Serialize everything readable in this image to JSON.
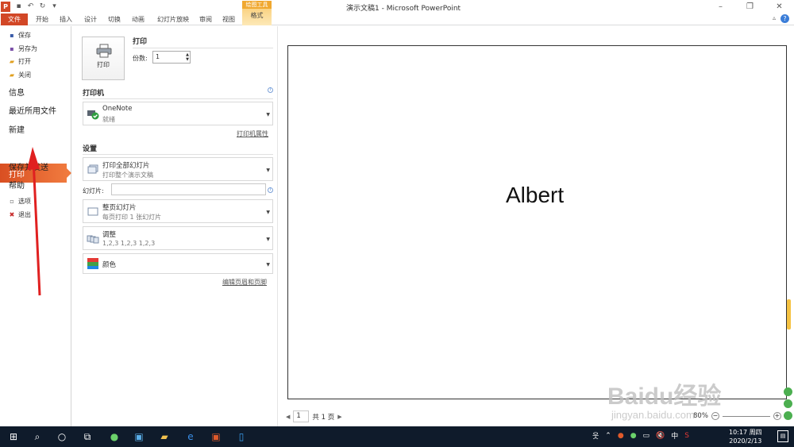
{
  "window": {
    "title": "演示文稿1 - Microsoft PowerPoint",
    "app_icon": "P",
    "controls": [
      "minimize-icon",
      "restore-icon",
      "close-icon"
    ]
  },
  "ribbon": {
    "tabs": [
      "文件",
      "开始",
      "插入",
      "设计",
      "切换",
      "动画",
      "幻灯片放映",
      "审阅",
      "视图"
    ],
    "context_group": "绘图工具",
    "context_tab": "格式"
  },
  "backstage": {
    "small_items": [
      {
        "label": "保存",
        "icon": "save-icon"
      },
      {
        "label": "另存为",
        "icon": "save-as-icon"
      },
      {
        "label": "打开",
        "icon": "open-folder-icon"
      },
      {
        "label": "关闭",
        "icon": "close-file-icon"
      }
    ],
    "big_items": [
      "信息",
      "最近所用文件",
      "新建",
      "打印",
      "保存并发送",
      "帮助"
    ],
    "selected": "打印",
    "bottom_items": [
      {
        "label": "选项",
        "icon": "options-icon"
      },
      {
        "label": "退出",
        "icon": "exit-icon"
      }
    ]
  },
  "print": {
    "button_label": "打印",
    "heading": "打印",
    "copies_label": "份数:",
    "copies_value": "1",
    "printer_heading": "打印机",
    "printer_name": "OneNote",
    "printer_status": "就绪",
    "printer_properties": "打印机属性",
    "settings_heading": "设置",
    "range_title": "打印全部幻灯片",
    "range_sub": "打印整个演示文稿",
    "slides_label": "幻灯片:",
    "slides_value": "",
    "layout_title": "整页幻灯片",
    "layout_sub": "每页打印 1 张幻灯片",
    "collate_title": "调整",
    "collate_sub": "1,2,3    1,2,3    1,2,3",
    "color_title": "颜色",
    "edit_header_footer": "编辑页眉和页脚"
  },
  "preview": {
    "slide_text": "Albert",
    "page_value": "1",
    "page_total": "共 1 页",
    "zoom": "80%"
  },
  "watermark": {
    "line1": "Baidu经验",
    "line2": "jingyan.baidu.com"
  },
  "taskbar": {
    "tray_ime": "中",
    "clock_time": "10:17 周四",
    "clock_date": "2020/2/13"
  }
}
